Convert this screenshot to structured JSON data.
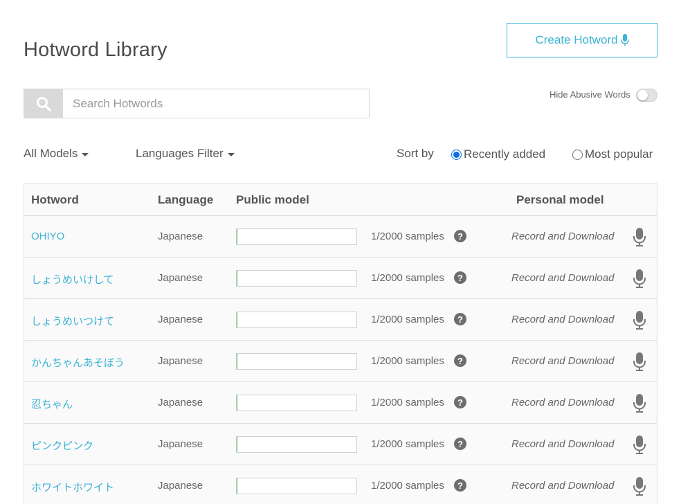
{
  "header": {
    "title": "Hotword Library",
    "create_label": "Create Hotword"
  },
  "search": {
    "placeholder": "Search Hotwords",
    "value": ""
  },
  "abusive": {
    "label": "Hide Abusive Words",
    "enabled": false
  },
  "filters": {
    "models_label": "All Models",
    "languages_label": "Languages Filter"
  },
  "sort": {
    "label": "Sort by",
    "options": [
      "Recently added",
      "Most popular"
    ],
    "selected": "Recently added"
  },
  "table": {
    "headers": {
      "hotword": "Hotword",
      "language": "Language",
      "public": "Public model",
      "personal": "Personal model"
    },
    "rows": [
      {
        "hotword": "OHIYO",
        "language": "Japanese",
        "samples": "1/2000 samples",
        "progress": 0.0005,
        "action": "Record and Download"
      },
      {
        "hotword": "しょうめいけして",
        "language": "Japanese",
        "samples": "1/2000 samples",
        "progress": 0.0005,
        "action": "Record and Download"
      },
      {
        "hotword": "しょうめいつけて",
        "language": "Japanese",
        "samples": "1/2000 samples",
        "progress": 0.0005,
        "action": "Record and Download"
      },
      {
        "hotword": "かんちゃんあそぼう",
        "language": "Japanese",
        "samples": "1/2000 samples",
        "progress": 0.0005,
        "action": "Record and Download"
      },
      {
        "hotword": "忍ちゃん",
        "language": "Japanese",
        "samples": "1/2000 samples",
        "progress": 0.0005,
        "action": "Record and Download"
      },
      {
        "hotword": "ピンクピンク",
        "language": "Japanese",
        "samples": "1/2000 samples",
        "progress": 0.0005,
        "action": "Record and Download"
      },
      {
        "hotword": "ホワイトホワイト",
        "language": "Japanese",
        "samples": "1/2000 samples",
        "progress": 0.0005,
        "action": "Record and Download"
      }
    ]
  },
  "colors": {
    "accent": "#3bb3d4",
    "progress": "#3cbf5c",
    "radio": "#0b6fe0"
  },
  "icons": {
    "search": "search-icon",
    "create": "microphone-icon",
    "help": "question-circle-icon",
    "record": "microphone-icon"
  }
}
